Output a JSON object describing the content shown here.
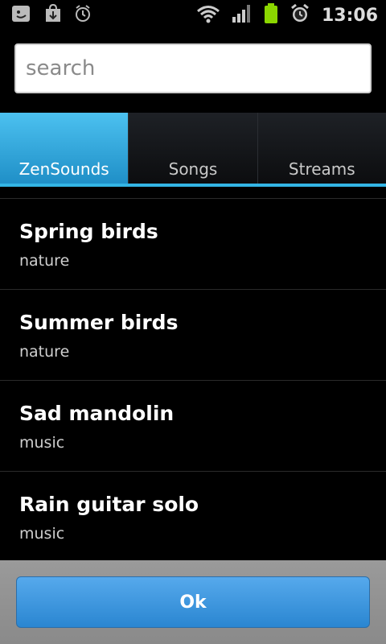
{
  "status_bar": {
    "time": "13:06",
    "icons_left": [
      "face-notification-icon",
      "download-notification-icon",
      "alarm-notification-icon"
    ],
    "icons_right": [
      "wifi-icon",
      "signal-icon",
      "battery-icon",
      "alarm-clock-icon"
    ],
    "battery_color": "#8bd600"
  },
  "search": {
    "placeholder": "search",
    "value": ""
  },
  "tabs": [
    {
      "label": "ZenSounds",
      "selected": true
    },
    {
      "label": "Songs",
      "selected": false
    },
    {
      "label": "Streams",
      "selected": false
    }
  ],
  "list": {
    "items": [
      {
        "title": "Spring birds",
        "subtitle": "nature"
      },
      {
        "title": "Summer birds",
        "subtitle": "nature"
      },
      {
        "title": "Sad mandolin",
        "subtitle": "music"
      },
      {
        "title": "Rain guitar solo",
        "subtitle": "music"
      }
    ]
  },
  "footer": {
    "ok_label": "Ok"
  },
  "colors": {
    "accent": "#33b5e5",
    "button": "#2a86d1"
  }
}
